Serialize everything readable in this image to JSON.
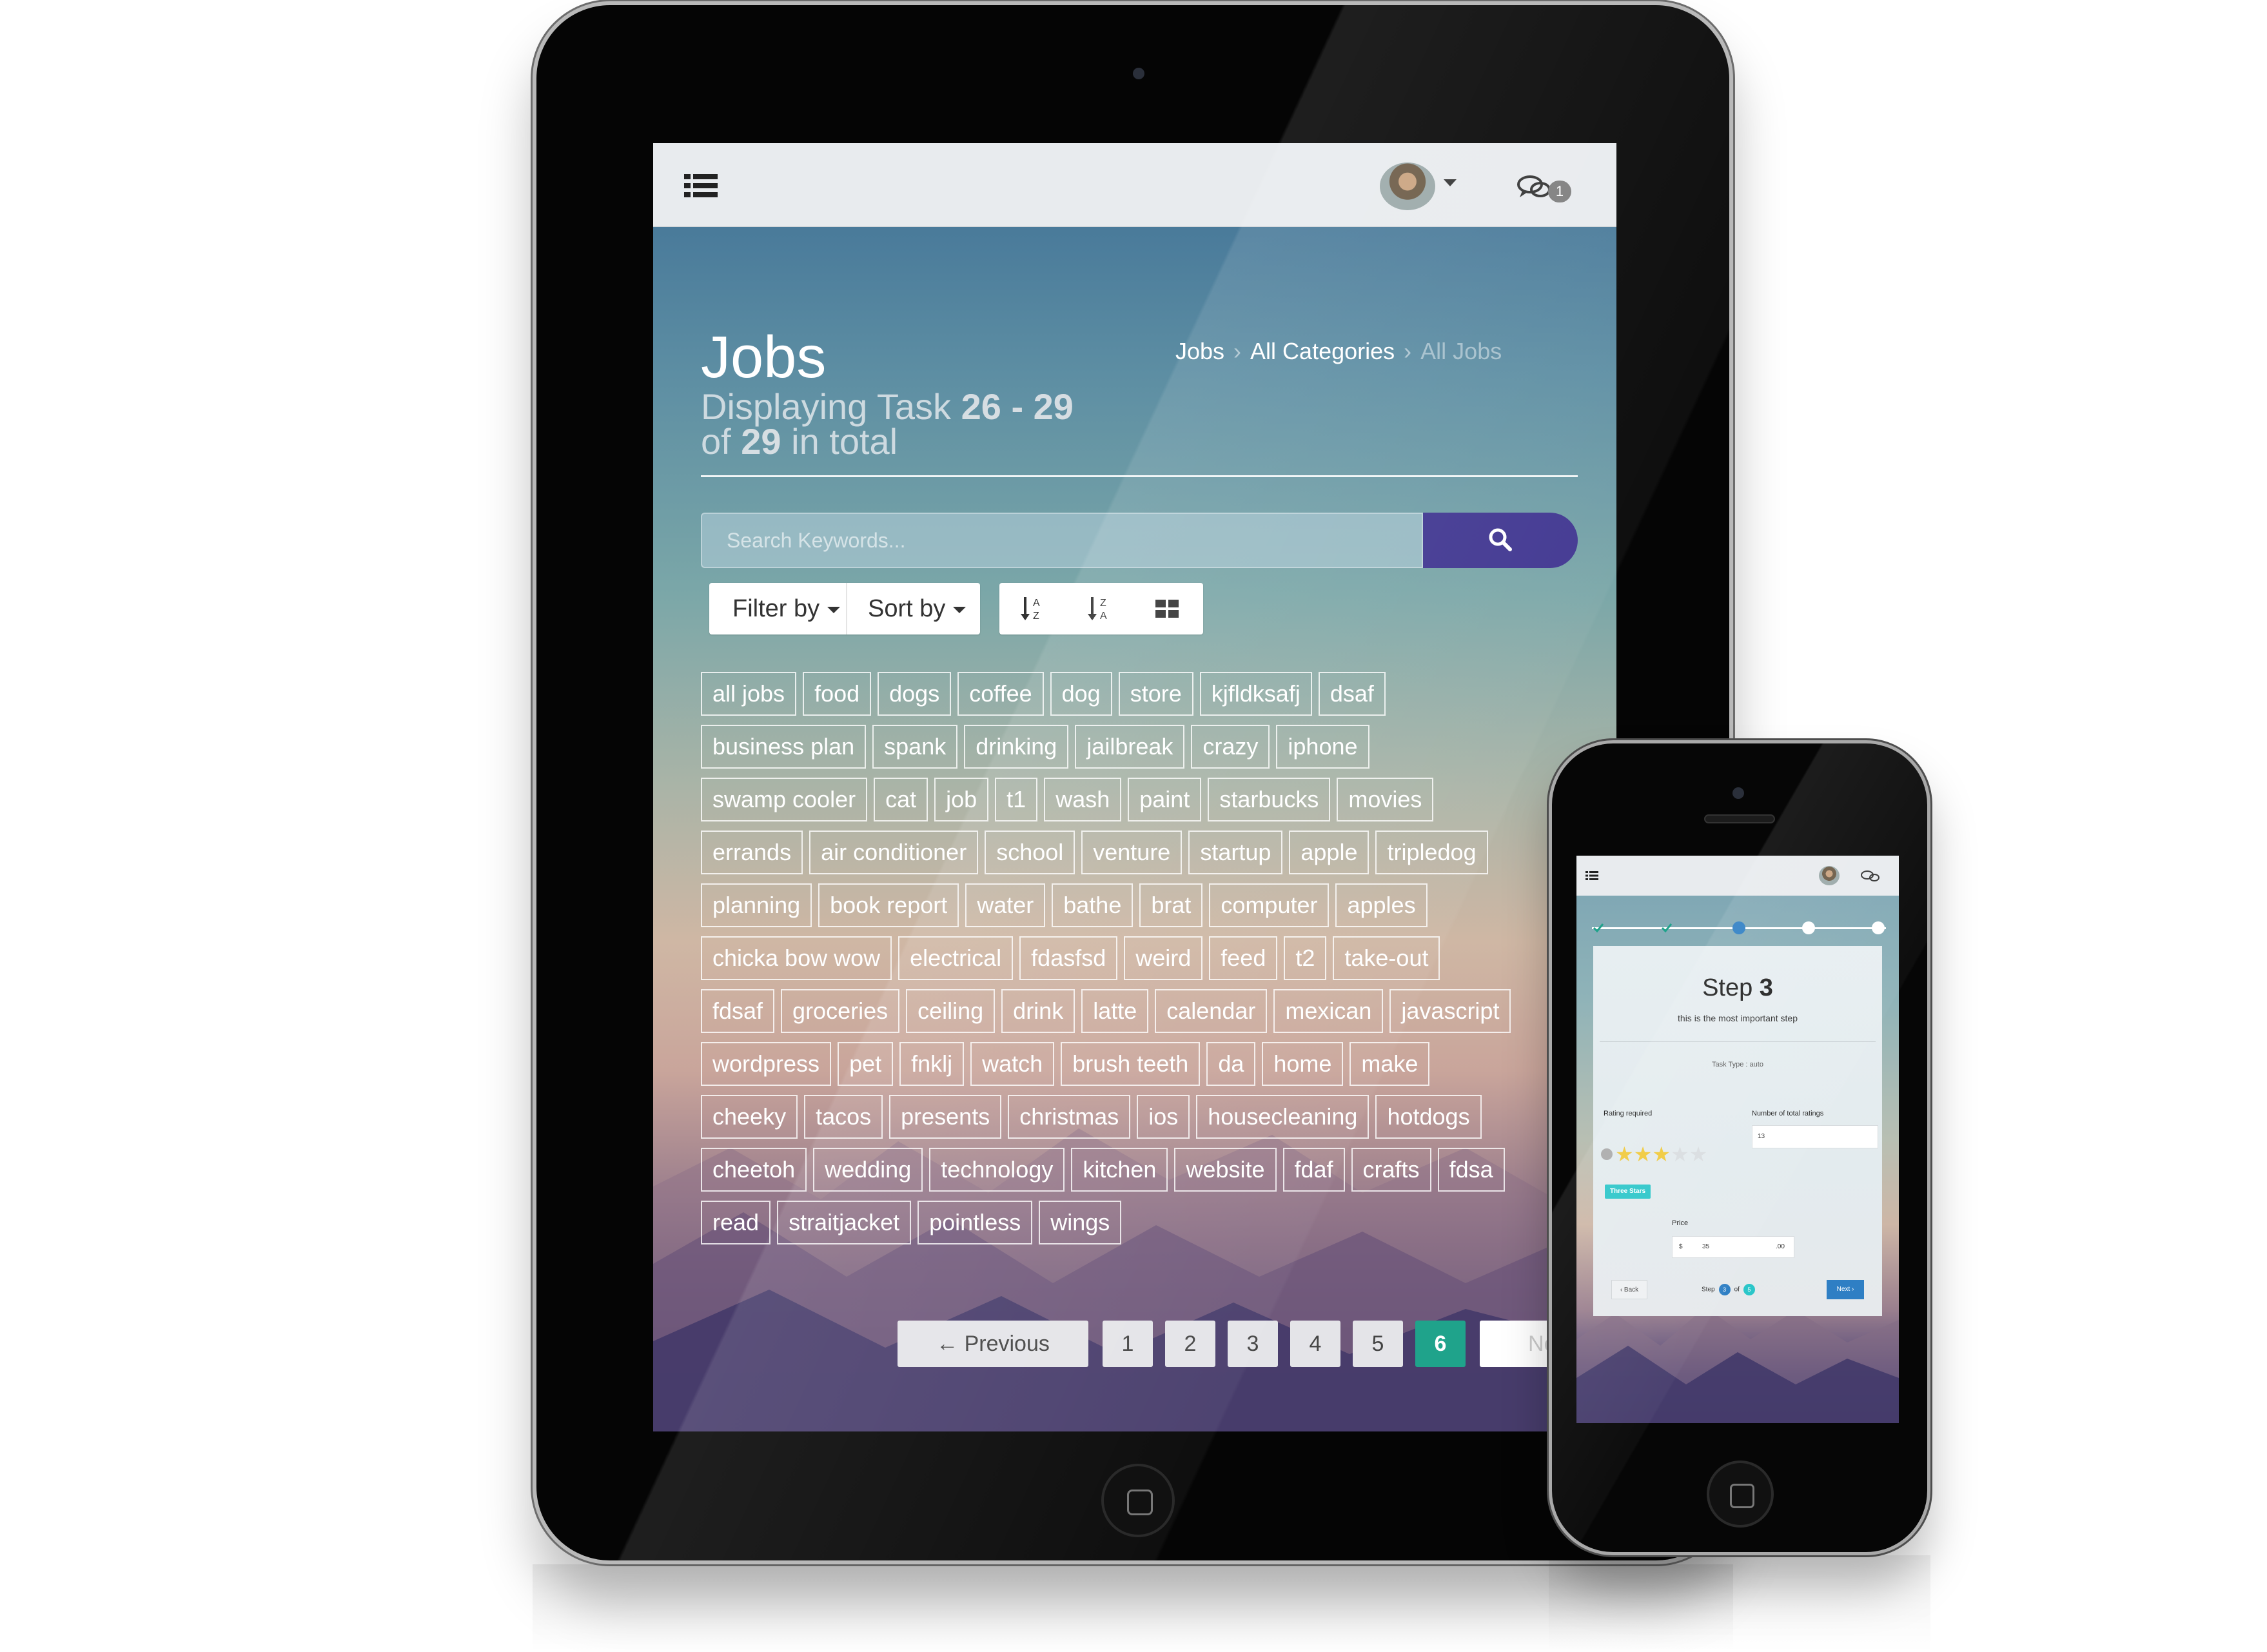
{
  "tablet": {
    "header": {
      "menu_icon": "list-icon",
      "chat_icon": "chat-bubbles-icon",
      "chat_badge": "1"
    },
    "page": {
      "title": "Jobs",
      "subtitle_prefix": "Displaying Task",
      "range": "26 - 29",
      "subtitle_of": "of",
      "total": "29",
      "subtitle_suffix": "in total",
      "breadcrumb": [
        "Jobs",
        "All Categories",
        "All Jobs"
      ]
    },
    "search": {
      "placeholder": "Search Keywords...",
      "button_icon": "search-icon"
    },
    "toolbar": {
      "filter_label": "Filter by",
      "sort_label": "Sort by",
      "sort_asc_icon": "sort-alpha-asc-icon",
      "sort_desc_icon": "sort-alpha-desc-icon",
      "grid_icon": "grid-view-icon"
    },
    "tag_rows": [
      [
        "all jobs",
        "food",
        "dogs",
        "coffee",
        "dog",
        "store",
        "kjfldksafj",
        "dsaf"
      ],
      [
        "business plan",
        "spank",
        "drinking",
        "jailbreak",
        "crazy",
        "iphone"
      ],
      [
        "swamp cooler",
        "cat",
        "job",
        "t1",
        "wash",
        "paint",
        "starbucks",
        "movies"
      ],
      [
        "errands",
        "air conditioner",
        "school",
        "venture",
        "startup",
        "apple",
        "tripledog"
      ],
      [
        "planning",
        "book report",
        "water",
        "bathe",
        "brat",
        "computer",
        "apples"
      ],
      [
        "chicka bow wow",
        "electrical",
        "fdasfsd",
        "weird",
        "feed",
        "t2",
        "take-out"
      ],
      [
        "fdsaf",
        "groceries",
        "ceiling",
        "drink",
        "latte",
        "calendar",
        "mexican",
        "javascript"
      ],
      [
        "wordpress",
        "pet",
        "fnklj",
        "watch",
        "brush teeth",
        "da",
        "home",
        "make"
      ],
      [
        "cheeky",
        "tacos",
        "presents",
        "christmas",
        "ios",
        "housecleaning",
        "hotdogs"
      ],
      [
        "cheetoh",
        "wedding",
        "technology",
        "kitchen",
        "website",
        "fdaf",
        "crafts",
        "fdsa"
      ],
      [
        "read",
        "straitjacket",
        "pointless",
        "wings"
      ]
    ],
    "pagination": {
      "previous": "← Previous",
      "pages": [
        "1",
        "2",
        "3",
        "4",
        "5",
        "6"
      ],
      "active": "6",
      "next": "Next"
    }
  },
  "phone": {
    "step_word": "Step",
    "step_number": "3",
    "step_description": "this is the most important step",
    "task_type": "Task Type : auto",
    "rating_label": "Rating required",
    "ratings_count_label": "Number of total ratings",
    "ratings_count_value": "13",
    "stars_selected": 3,
    "stars_total": 5,
    "rating_badge": "Three Stars",
    "price_label": "Price",
    "price_currency": "$",
    "price_value": "35",
    "price_cents": ".00",
    "back_label": "‹ Back",
    "footer_step": "Step",
    "footer_current": "3",
    "footer_of": "of",
    "footer_total": "5",
    "next_label": "Next ›",
    "accent": "#2f7fc4",
    "badge_color": "#2bc6c9"
  },
  "colors": {
    "search_button": "#3f3590",
    "active_page": "#1fa38b"
  }
}
